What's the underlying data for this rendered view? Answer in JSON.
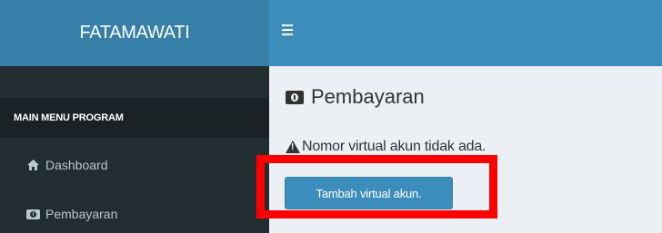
{
  "brand": {
    "title": "FATAMAWATI"
  },
  "sidebar": {
    "header": "MAIN MENU PROGRAM",
    "items": [
      {
        "label": "Dashboard",
        "icon": "home-icon"
      },
      {
        "label": "Pembayaran",
        "icon": "money-icon"
      }
    ]
  },
  "topbar": {
    "toggle_icon": "hamburger-icon"
  },
  "main": {
    "title": "Pembayaran",
    "title_icon": "money-icon",
    "alert": "Nomor virtual akun tidak ada.",
    "alert_icon": "warning-icon",
    "add_button_label": "Tambah virtual akun."
  },
  "colors": {
    "brand_bg": "#367fa9",
    "topbar_bg": "#3c8dbc",
    "sidebar_bg": "#222d32",
    "content_bg": "#ecf0f5",
    "highlight": "#ff0000"
  }
}
